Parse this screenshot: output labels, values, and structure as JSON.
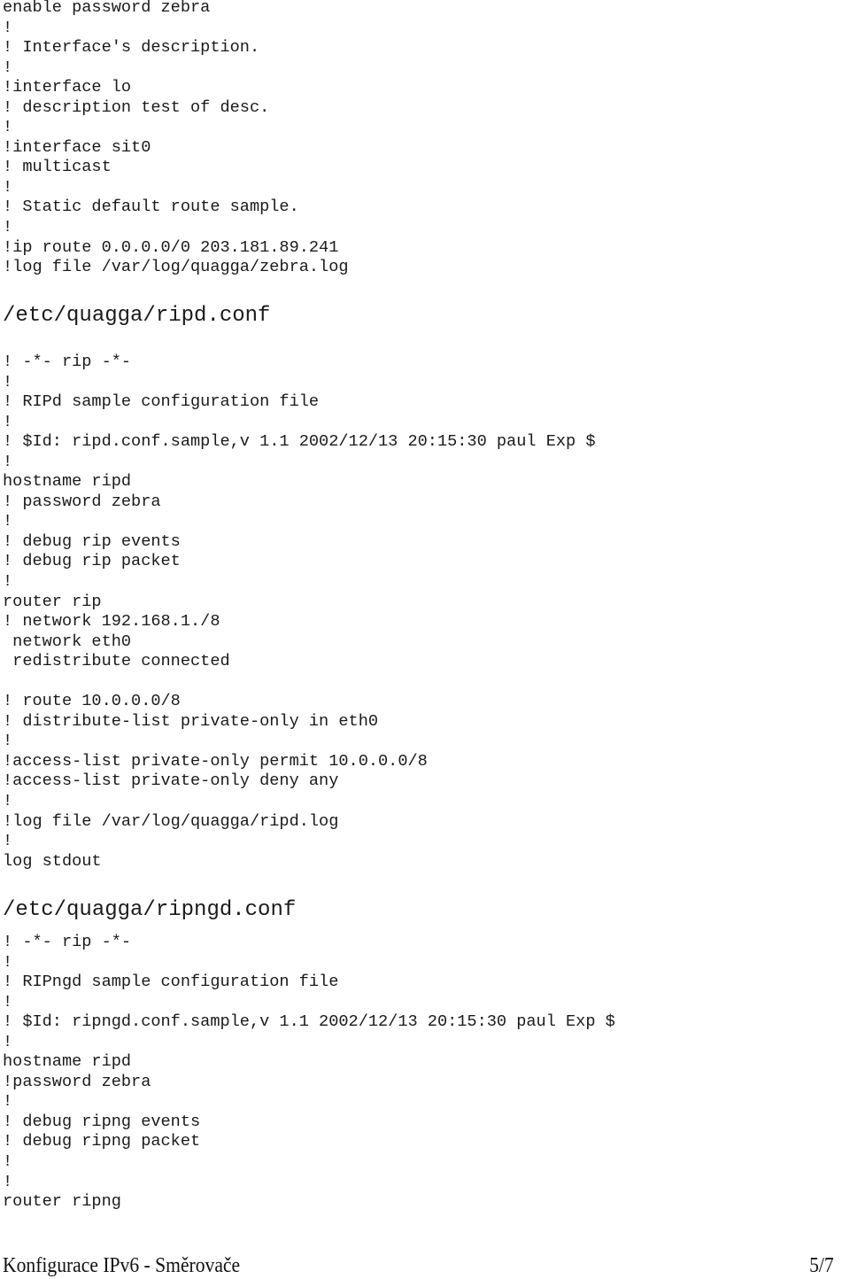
{
  "zebra_conf_tail": {
    "lines": [
      "enable password zebra",
      "!",
      "! Interface's description.",
      "!",
      "!interface lo",
      "! description test of desc.",
      "!",
      "!interface sit0",
      "! multicast",
      "!",
      "! Static default route sample.",
      "!",
      "!ip route 0.0.0.0/0 203.181.89.241",
      "!log file /var/log/quagga/zebra.log"
    ]
  },
  "ripd_conf": {
    "heading": "/etc/quagga/ripd.conf",
    "lines": [
      "! -*- rip -*-",
      "!",
      "! RIPd sample configuration file",
      "!",
      "! $Id: ripd.conf.sample,v 1.1 2002/12/13 20:15:30 paul Exp $",
      "!",
      "hostname ripd",
      "! password zebra",
      "!",
      "! debug rip events",
      "! debug rip packet",
      "!",
      "router rip",
      "! network 192.168.1./8",
      " network eth0",
      " redistribute connected",
      "",
      "! route 10.0.0.0/8",
      "! distribute-list private-only in eth0",
      "!",
      "!access-list private-only permit 10.0.0.0/8",
      "!access-list private-only deny any",
      "!",
      "!log file /var/log/quagga/ripd.log",
      "!",
      "log stdout"
    ]
  },
  "ripngd_conf": {
    "heading": "/etc/quagga/ripngd.conf",
    "lines": [
      "! -*- rip -*-",
      "!",
      "! RIPngd sample configuration file",
      "!",
      "! $Id: ripngd.conf.sample,v 1.1 2002/12/13 20:15:30 paul Exp $",
      "!",
      "hostname ripd",
      "!password zebra",
      "!",
      "! debug ripng events",
      "! debug ripng packet",
      "!",
      "!",
      "router ripng"
    ]
  },
  "footer": {
    "title": "Konfigurace IPv6 - Směrovače",
    "page": "5/7"
  }
}
